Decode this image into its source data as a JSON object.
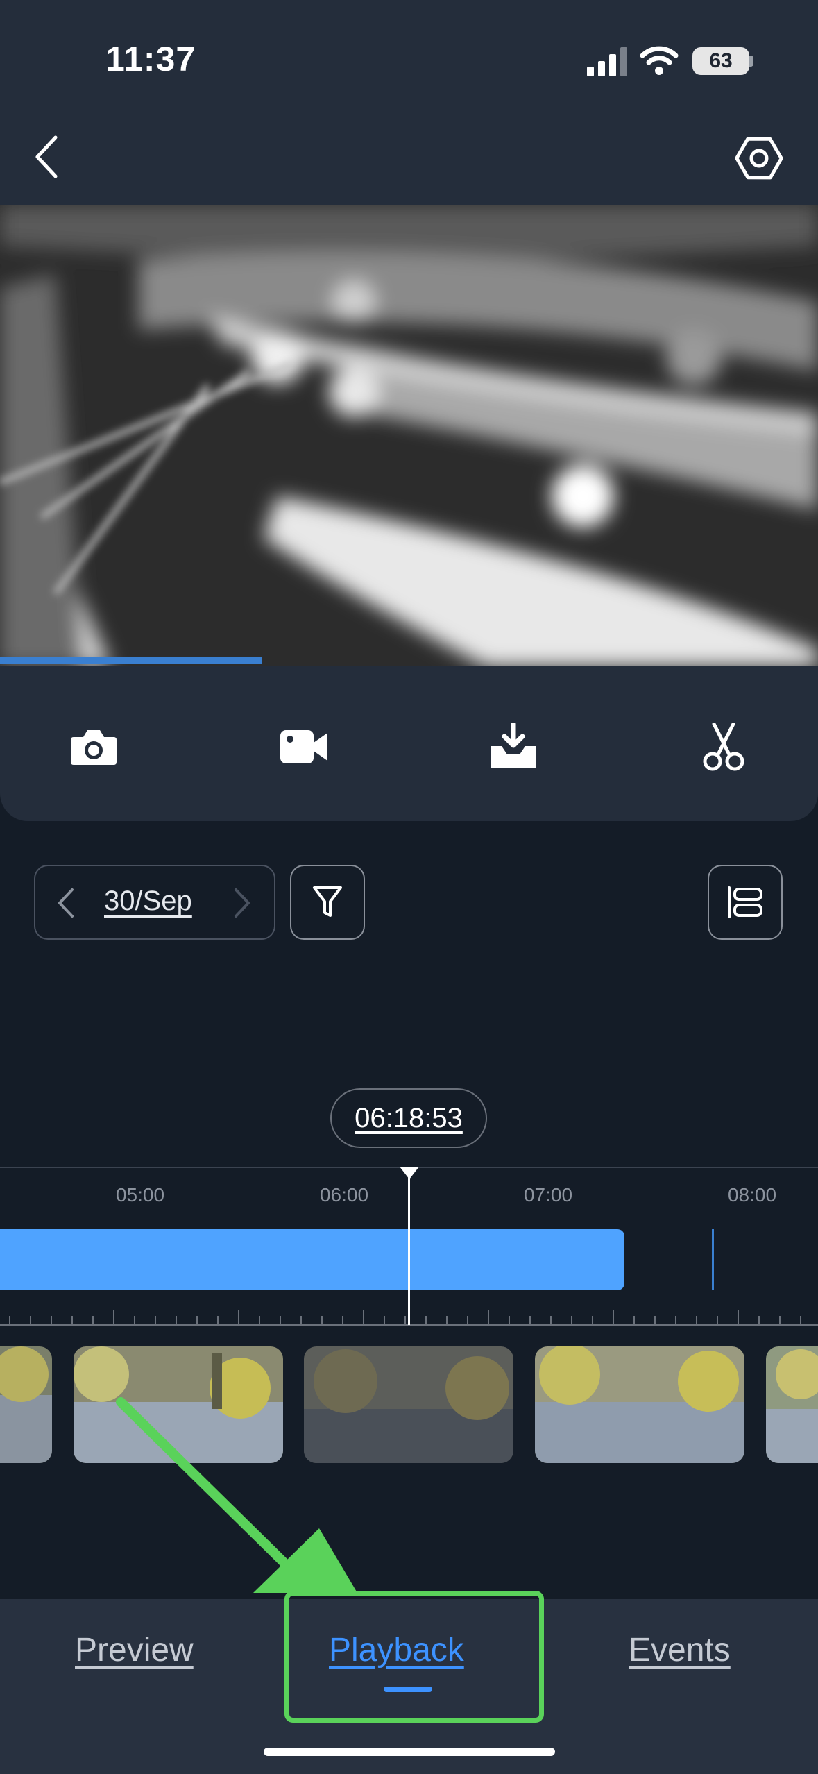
{
  "status_bar": {
    "time": "11:37",
    "battery": "63",
    "icons": [
      "signal-icon",
      "wifi-icon",
      "battery-icon"
    ]
  },
  "header": {
    "back_icon": "chevron-left-icon",
    "settings_icon": "hexagon-settings-icon"
  },
  "video": {
    "progress_fraction": 0.32
  },
  "toolbar": {
    "items": [
      "camera-icon",
      "video-camera-icon",
      "download-icon",
      "scissors-icon"
    ]
  },
  "date_selector": {
    "date": "30/Sep",
    "prev_icon": "chevron-left-icon",
    "next_icon": "chevron-right-icon"
  },
  "filter": {
    "icon": "filter-icon"
  },
  "view_toggle": {
    "icon": "list-view-icon"
  },
  "timeline": {
    "current_time": "06:18:53",
    "hours": [
      "05:00",
      "06:00",
      "07:00",
      "08:00"
    ]
  },
  "bottom_nav": {
    "tabs": [
      "Preview",
      "Playback",
      "Events"
    ],
    "active": "Playback"
  },
  "annotation": {
    "color": "#5ad25a"
  },
  "colors": {
    "accent": "#3d92ff",
    "recording_bar": "#4fa3ff",
    "panel_bg": "#242d3b",
    "page_bg": "#141c27"
  }
}
